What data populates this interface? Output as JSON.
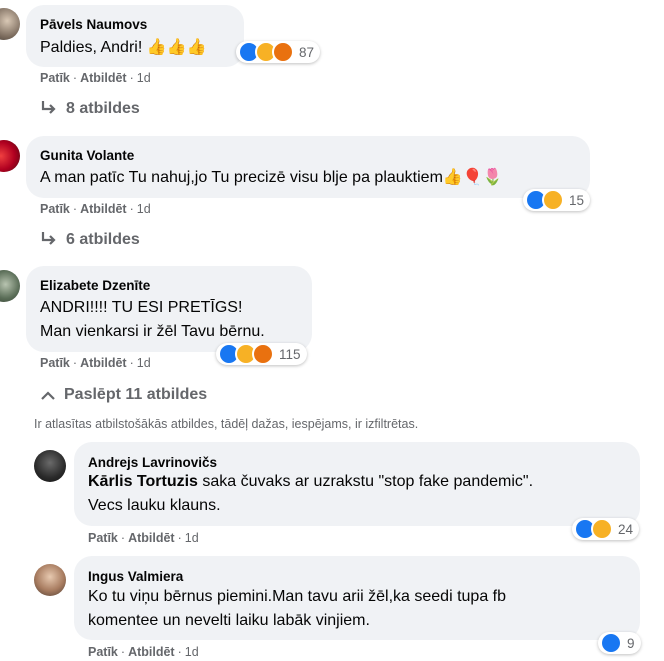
{
  "actions": {
    "like": "Patīk",
    "reply": "Atbildēt",
    "sep": "·"
  },
  "comments": [
    {
      "author": "Pāvels Naumovs",
      "lines": [
        "Paldies, Andri! 👍👍👍"
      ],
      "reactions": "87",
      "time": "1d",
      "replies": "8 atbildes"
    },
    {
      "author": "Gunita Volante",
      "lines": [
        "A man patīc Tu nahuj,jo Tu precizē visu blje pa plauktiem👍🎈🌷"
      ],
      "reactions": "15",
      "time": "1d",
      "replies": "6 atbildes"
    },
    {
      "author": "Elizabete Dzenīte",
      "lines": [
        "ANDRI!!!! TU ESI PRETĪGS!",
        "Man vienkarsi ir žēl Tavu bērnu."
      ],
      "reactions": "115",
      "time": "1d",
      "replies": "Paslēpt 11 atbildes"
    }
  ],
  "filter_note": "Ir atlasītas atbilstošākās atbildes, tādēļ dažas, iespējams, ir izfiltrētas.",
  "replies": [
    {
      "author": "Andrejs Lavrinovičs",
      "tag": "Kārlis Tortuzis",
      "lines": [
        " saka čuvaks ar uzrakstu \"stop fake pandemic\".",
        "Vecs lauku klauns."
      ],
      "reactions": "24",
      "time": "1d"
    },
    {
      "author": "Ingus Valmiera",
      "lines": [
        "Ko tu viņu bērnus piemini.Man tavu arii žēl,ka seedi tupa fb",
        "komentee un nevelti laiku labāk vinjiem."
      ],
      "reactions": "9",
      "time": "1d"
    }
  ]
}
